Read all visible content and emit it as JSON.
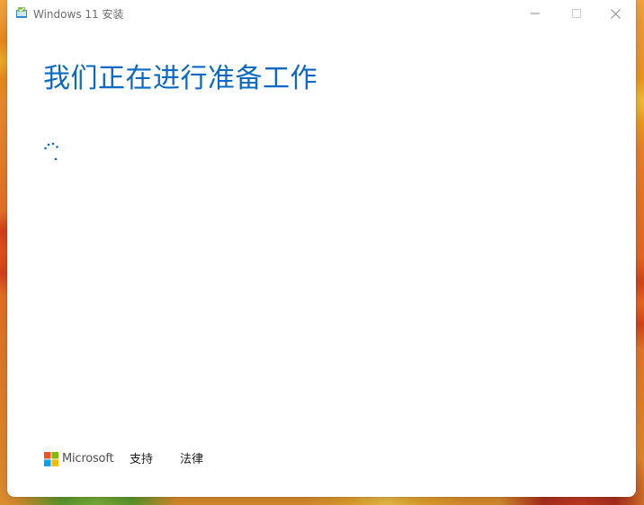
{
  "window": {
    "title": "Windows 11 安装",
    "controls": {
      "minimize_icon": "minimize-icon",
      "maximize_icon": "maximize-icon",
      "close_icon": "close-icon"
    }
  },
  "main": {
    "heading": "我们正在进行准备工作",
    "spinner_icon": "loading-spinner-icon",
    "accent_color": "#0a69c2"
  },
  "footer": {
    "brand": "Microsoft",
    "links": [
      {
        "label": "支持"
      },
      {
        "label": "法律"
      }
    ]
  },
  "colors": {
    "logo_red": "#f25022",
    "logo_green": "#7fba00",
    "logo_blue": "#00a4ef",
    "logo_yellow": "#ffb900"
  }
}
